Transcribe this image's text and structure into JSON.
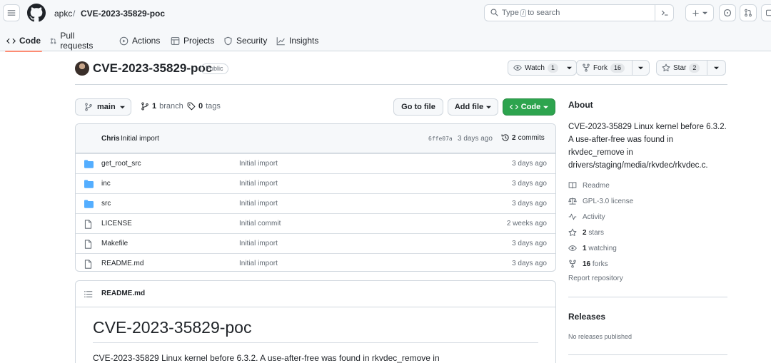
{
  "header": {
    "owner": "apkc",
    "separator": "/",
    "repo": "CVE-2023-35829-poc",
    "search": {
      "prefix": "Type",
      "key": "/",
      "suffix": "to search"
    }
  },
  "tabs": [
    {
      "label": "Code",
      "icon": "code-icon",
      "active": true
    },
    {
      "label": "Pull requests",
      "icon": "git-pull-request-icon"
    },
    {
      "label": "Actions",
      "icon": "play-icon"
    },
    {
      "label": "Projects",
      "icon": "table-icon"
    },
    {
      "label": "Security",
      "icon": "shield-icon"
    },
    {
      "label": "Insights",
      "icon": "graph-icon"
    }
  ],
  "repo": {
    "name": "CVE-2023-35829-poc",
    "visibility": "Public",
    "watch": {
      "label": "Watch",
      "count": "1"
    },
    "fork": {
      "label": "Fork",
      "count": "16"
    },
    "star": {
      "label": "Star",
      "count": "2"
    }
  },
  "branchbar": {
    "branch": "main",
    "branches_count": "1",
    "branches_label": "branch",
    "tags_count": "0",
    "tags_label": "tags",
    "go_to_file": "Go to file",
    "add_file": "Add file",
    "code": "Code"
  },
  "commit": {
    "author": "Chris",
    "message": "Initial import",
    "sha": "6ffe07a",
    "time": "3 days ago",
    "commits_count": "2",
    "commits_label": "commits"
  },
  "files": [
    {
      "name": "get_root_src",
      "type": "dir",
      "message": "Initial import",
      "age": "3 days ago"
    },
    {
      "name": "inc",
      "type": "dir",
      "message": "Initial import",
      "age": "3 days ago"
    },
    {
      "name": "src",
      "type": "dir",
      "message": "Initial import",
      "age": "3 days ago"
    },
    {
      "name": "LICENSE",
      "type": "file",
      "message": "Initial commit",
      "age": "2 weeks ago"
    },
    {
      "name": "Makefile",
      "type": "file",
      "message": "Initial import",
      "age": "3 days ago"
    },
    {
      "name": "README.md",
      "type": "file",
      "message": "Initial import",
      "age": "3 days ago"
    }
  ],
  "readme": {
    "title": "README.md",
    "heading": "CVE-2023-35829-poc",
    "paragraph": "CVE-2023-35829 Linux kernel before 6.3.2. A use-after-free was found in rkvdec_remove in"
  },
  "about": {
    "heading": "About",
    "description": "CVE-2023-35829 Linux kernel before 6.3.2. A use-after-free was found in rkvdec_remove in drivers/staging/media/rkvdec/rkvdec.c.",
    "readme": "Readme",
    "license": "GPL-3.0 license",
    "activity": "Activity",
    "stars_count": "2",
    "stars_label": "stars",
    "watching_count": "1",
    "watching_label": "watching",
    "forks_count": "16",
    "forks_label": "forks",
    "report": "Report repository"
  },
  "releases": {
    "heading": "Releases",
    "empty": "No releases published"
  },
  "colors": {
    "accent_tab": "#fd8c73",
    "folder": "#54aeff",
    "green_button": "#2da44e"
  }
}
